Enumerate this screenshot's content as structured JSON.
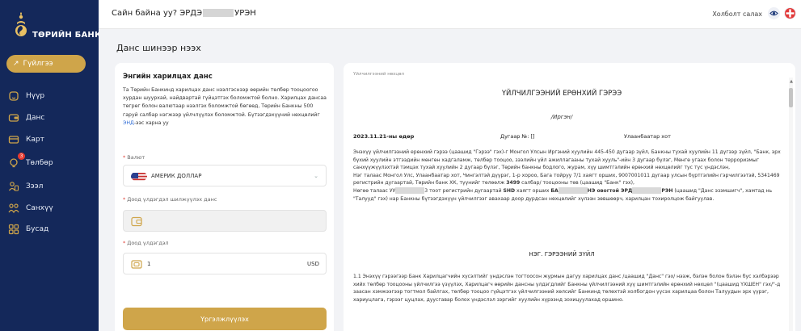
{
  "brand": {
    "name": "ТӨРИЙН БАНК"
  },
  "nav": {
    "primary": "Гүйлгээ",
    "items": [
      {
        "label": "Нүүр",
        "icon": "home-icon"
      },
      {
        "label": "Данс",
        "icon": "account-card-icon"
      },
      {
        "label": "Карт",
        "icon": "card-icon"
      },
      {
        "label": "Төлбөр",
        "icon": "bulb-icon",
        "badge": "3"
      },
      {
        "label": "Зээл",
        "icon": "loan-icon"
      },
      {
        "label": "Санхүү",
        "icon": "finance-icon"
      },
      {
        "label": "Бусад",
        "icon": "grid-icon"
      }
    ]
  },
  "header": {
    "greeting_prefix": "Сайн байна уу? ЭРДЭ",
    "greeting_suffix": "УРЭН",
    "logout": "Холболт салах"
  },
  "page": {
    "title": "Данс шинээр нээх"
  },
  "form": {
    "heading": "Энгийн харилцах данс",
    "desc_main": "Та Төрийн Банкинд харилцах данс нээлгэснээр өөрийн төлбөр тооцоогоо хурдан шуурхай, найдвартай гүйцэтгэх боломжтой болно. Харилцах дансаа төгрөг болон валютаар нээлгэх боломжтой бөгөөд, Төрийн Банкны 500 гаруй салбар нэгжээр үйлчлүүлэх боломжтой. Бүтээгдэхүүний нөхцөлийг ",
    "desc_link": "ЭНД",
    "desc_end": "-ээс харна уу",
    "currency_label": "Валют",
    "currency_value": "АМЕРИК ДОЛЛАР",
    "source_label": "Доод үлдэгдэл шилжүүлэх данс",
    "balance_label": "Доод үлдэгдэл",
    "balance_value": "1",
    "balance_unit": "USD",
    "submit": "Үргэлжлүүлэх"
  },
  "terms": {
    "label": "Үйлчилгээний нөхцөл",
    "title": "ҮЙЛЧИЛГЭЭНИЙ ЕРӨНХИЙ ГЭРЭЭ",
    "subtitle": "/Иргэн/",
    "date": "2023.11.21-ны өдөр",
    "number": "Дугаар №: []",
    "city": "Улаанбаатар хот",
    "p1": "Энэхүү үйлчилгээний ерөнхий гэрээ (цаашид \"Гэрээ\" гэх)-г Монгол Улсын Иргэний хуулийн 445-450 дугаар зүйл, Банкны тухай хуулийн 11 дүгээр зүйл, \"Банк, эрх бүхий хуулийн этгээдийн мөнгөн хадгаламж, төлбөр тооцоо, зээлийн үйл ажиллагааны тухай хууль\"-ийн 3 дугаар бүлэг, Мөнгө угаах болон терроризмыг санхүүжүүлэхтэй тэмцэх тухай хуулийн 2 дугаар бүлэг, Төрийн банкны бодлого, журам, хүү шимтгэлийн ерөнхий нөхцөлийг тус тус үндэслэн,",
    "p2a": "Нэг талаас Монгол Улс, Улаанбаатар хот, Чингэлтэй дүүрэг, 1-р хороо, Бага тойруу 7/1 хаягт орших, 9007001011 дугаар улсын бүртгэлийн гэрчилгээтэй, 5341469 регистрийн дугаартай, Төрийн банк ХК, түүнийг төлөөлж ",
    "p2b": "3499",
    "p2c": " салбар/ тооцооны төв (цаашид \"Банк\" гэх),",
    "p3a": "Нөгөө талаас УУ",
    "p3b": "3 тоот регистрийн дугаартай ",
    "p3c": "SHD",
    "p3d": " хаягт орших ",
    "p3e": "БА",
    "p3f": "НЭ овогтой ",
    "p3g": "ЭРД",
    "p3h": "РЭН",
    "p3i": " (цаашид \"Данс эзэмшигч\", хамтад нь \"Талууд\" гэх) нар Банкны бүтээгдэхүүн үйлчилгээг авахаар доор дурдсан нөхцөлийг хүлээн зөвшөөрч, харилцан тохиролцож байгуулав.",
    "section": "НЭГ. ГЭРЭЭНИЙ ЗҮЙЛ",
    "p4": "1.1 Энэхүү гэрээгээр Банк Харилцагчийн хүсэлтийг үндэслэн тогтоосон журмын дагуу харилцах данс /цаашид \"Данс\" гэх/ нээж, бэлэн болон бэлэн бус хэлбэрээр хийх төлбөр тооцооны үйлчилгээ үзүүлэх, Харилцагч өөрийн дансны үлдэгдлийг Банкны үйлчилгээний хүү шимтгэлийн ерөнхий нөхцөл \"(цаашид ҮХШЕН\" гэх/\"-д заасан хэмжээгээр тогтмол байлгах, төлбөр тооцоо гүйцэтгэх үйлчилгээний хөлсийг Банкинд төлөхтэй холбогдон үүсэх харилцаа болон Талуудын эрх үүрэг, хариуцлага, гэрээг цуцлах, дуусгавар болох үндэслэл зэргийг хуулийн хүрээнд зохицуулахад оршино."
  },
  "colors": {
    "sidebar": "#14285a",
    "accent": "#cfa54a",
    "link": "#2d6bd6",
    "background": "#f2f3f6"
  }
}
